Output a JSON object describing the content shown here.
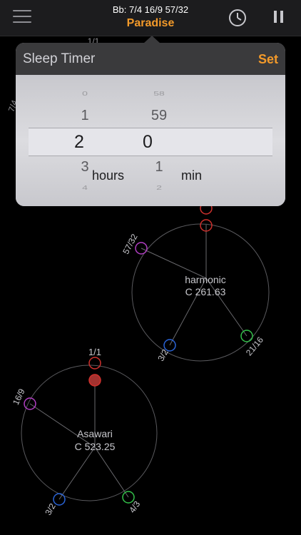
{
  "header": {
    "subtitle": "Bb: 7/4 16/9 57/32",
    "title": "Paradise"
  },
  "icons": {
    "menu": "hamburger-menu-icon",
    "clock": "clock-icon",
    "pause": "pause-icon"
  },
  "popover": {
    "title": "Sleep Timer",
    "set_label": "Set",
    "hours_wheel": {
      "rows": [
        "0",
        "1",
        "2",
        "3",
        "4"
      ],
      "selected": "2",
      "unit": "hours"
    },
    "min_wheel": {
      "rows": [
        "58",
        "59",
        "0",
        "1",
        "2"
      ],
      "selected": "0",
      "unit": "min"
    }
  },
  "top_partial_labels": {
    "a": "1/1",
    "b": "7/4"
  },
  "wheels": [
    {
      "name": "harmonic",
      "center_label": "harmonic",
      "freq_label": "C 261.63",
      "ring_color": "#5a5a5e",
      "nodes": [
        {
          "label": "",
          "color": "#d0312d",
          "filled": false
        },
        {
          "label": "",
          "color": "#d0312d",
          "filled": false
        },
        {
          "label": "57/32",
          "color": "#b23fc4",
          "filled": false
        },
        {
          "label": "21/16",
          "color": "#33c24a",
          "filled": false
        },
        {
          "label": "3/2",
          "color": "#2a64d8",
          "filled": false
        }
      ]
    },
    {
      "name": "asawari",
      "center_label": "Asawari",
      "freq_label": "C 523.25",
      "ring_color": "#5a5a5e",
      "nodes": [
        {
          "label": "1/1",
          "color": "#d0312d",
          "filled": false
        },
        {
          "label": "",
          "color": "#d0312d",
          "filled": true
        },
        {
          "label": "16/9",
          "color": "#b23fc4",
          "filled": false
        },
        {
          "label": "4/3",
          "color": "#33c24a",
          "filled": false
        },
        {
          "label": "3/2",
          "color": "#2a64d8",
          "filled": false
        }
      ]
    }
  ],
  "colors": {
    "accent": "#f39a2a",
    "background": "#000000",
    "label": "#c7c7cc"
  }
}
